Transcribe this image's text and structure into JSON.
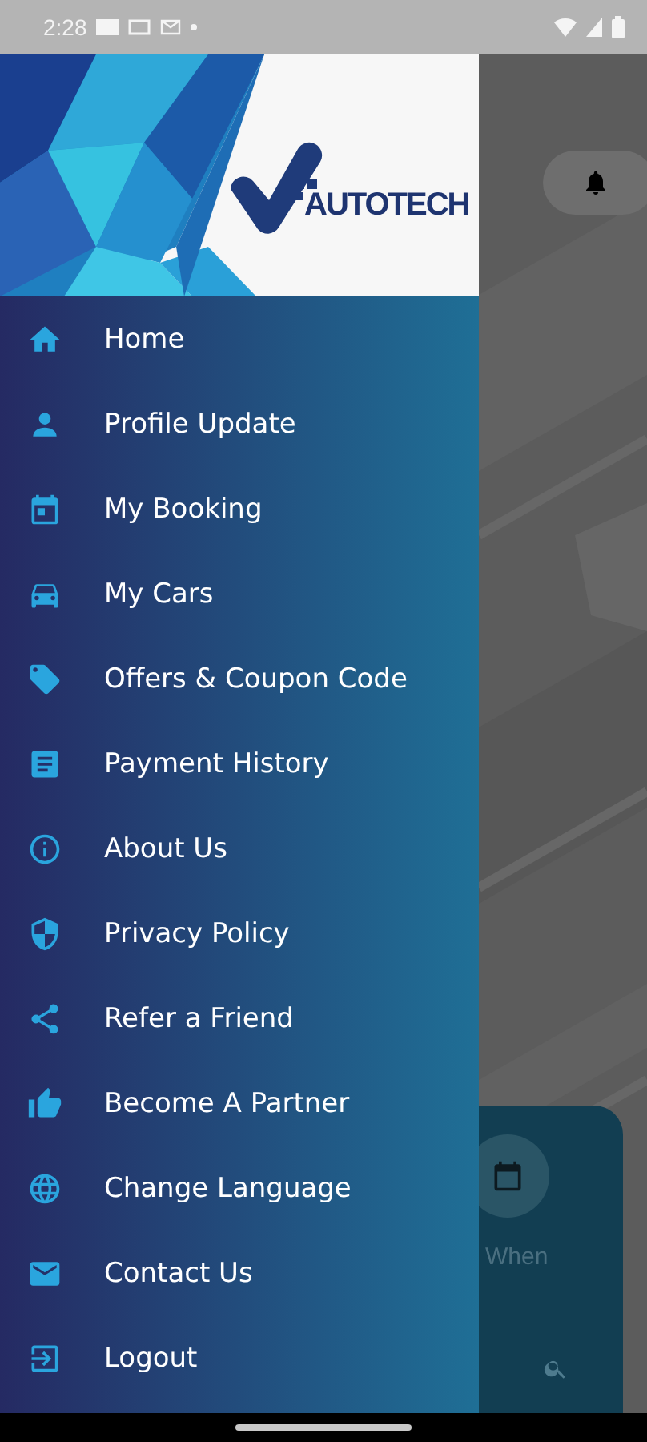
{
  "status_bar": {
    "time": "2:28"
  },
  "drawer": {
    "logo_text": "AUTOTECH",
    "items": [
      {
        "label": "Home"
      },
      {
        "label": "Profile Update"
      },
      {
        "label": "My Booking"
      },
      {
        "label": "My Cars"
      },
      {
        "label": "Offers & Coupon Code"
      },
      {
        "label": "Payment History"
      },
      {
        "label": "About Us"
      },
      {
        "label": "Privacy Policy"
      },
      {
        "label": "Refer a Friend"
      },
      {
        "label": "Become A Partner"
      },
      {
        "label": "Change Language"
      },
      {
        "label": "Contact Us"
      },
      {
        "label": "Logout"
      }
    ]
  },
  "booking_card": {
    "when_label": "When"
  }
}
